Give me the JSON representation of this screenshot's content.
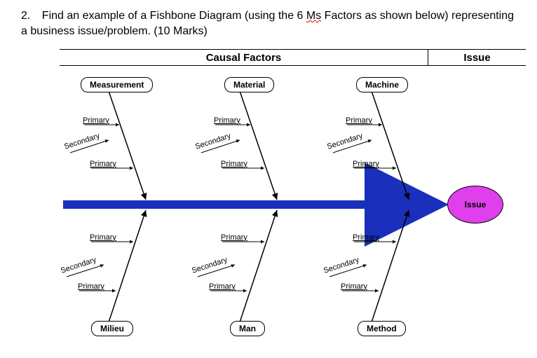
{
  "question": {
    "number": "2.",
    "text_part1": "Find an example of a Fishbone Diagram (using the 6 ",
    "text_wavy": "Ms",
    "text_part2": " Factors as shown below) representing a business issue/problem. (10 Marks)"
  },
  "headers": {
    "causal": "Causal Factors",
    "issue": "Issue"
  },
  "categories": {
    "top": [
      "Measurement",
      "Material",
      "Machine"
    ],
    "bottom": [
      "Milieu",
      "Man",
      "Method"
    ]
  },
  "labels": {
    "primary": "Primary",
    "secondary": "Secondary"
  },
  "issue_label": "Issue",
  "colors": {
    "spine": "#1a2fbb",
    "issue_fill": "#e040ec"
  }
}
